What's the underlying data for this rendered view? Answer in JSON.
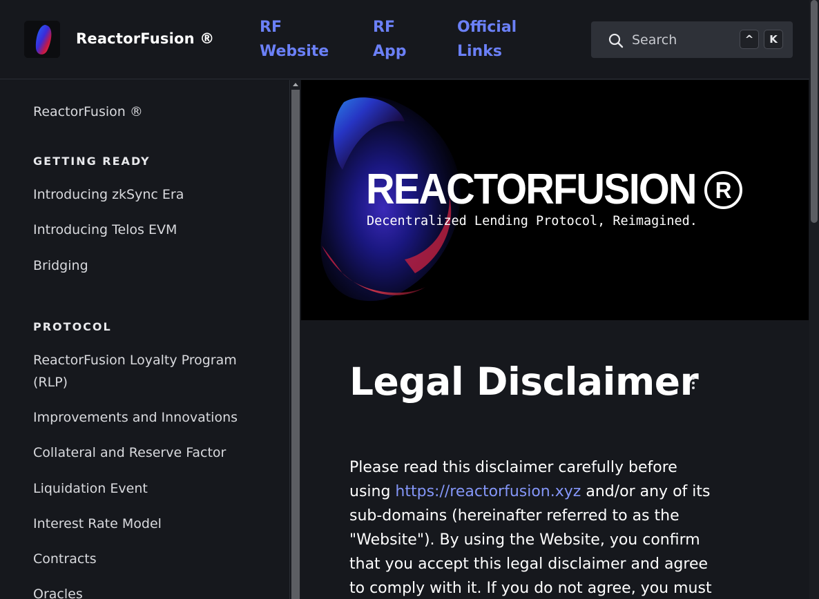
{
  "header": {
    "brand": "ReactorFusion ®",
    "nav": [
      {
        "label_line1": "RF",
        "label_line2": "Website"
      },
      {
        "label_line1": "RF",
        "label_line2": "App"
      },
      {
        "label_line1": "Official",
        "label_line2": "Links"
      }
    ],
    "search": {
      "placeholder": "Search",
      "shortcut_keys": [
        "^",
        "K"
      ]
    }
  },
  "sidebar": {
    "home": "ReactorFusion ®",
    "sections": [
      {
        "heading": "GETTING READY",
        "items": [
          "Introducing zkSync Era",
          "Introducing Telos EVM",
          "Bridging"
        ]
      },
      {
        "heading": "PROTOCOL",
        "items": [
          "ReactorFusion Loyalty Program",
          "(RLP)",
          "Improvements and Innovations",
          "Collateral and Reserve Factor",
          "Liquidation Event",
          "Interest Rate Model",
          "Contracts",
          "Oracles"
        ]
      }
    ]
  },
  "banner": {
    "title": "REACTORFUSION",
    "registered": "R",
    "tagline": "Decentralized Lending Protocol, Reimagined."
  },
  "content": {
    "title": "Legal Disclaimer",
    "para_before_link": "Please read this disclaimer carefully before using ",
    "link_text": "https://reactorfusion.xyz",
    "para_after_link": " and/or any of its sub-domains (hereinafter referred to as the \"Website\"). By using the Website, you confirm that you accept this legal disclaimer and agree to comply with it. If you do not agree, you must"
  },
  "colors": {
    "background": "#16181d",
    "link": "#6b80f7",
    "search_bg": "#2e3138"
  },
  "icons": [
    "search-icon",
    "more-options-icon",
    "logo-icon"
  ]
}
